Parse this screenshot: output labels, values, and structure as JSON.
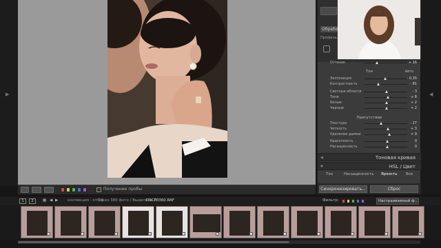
{
  "panel": {
    "tab_label": "Обработка",
    "profile_label": "Профиль:",
    "tone_title": "Тон",
    "tone_auto": "Авто",
    "presence_title": "Присутствие",
    "tone_rows": [
      {
        "label": "Оттенок",
        "value": "+ 16"
      },
      {
        "label": "Экспозиция",
        "value": "- 0,35"
      },
      {
        "label": "Контрастность",
        "value": "- 81"
      },
      {
        "label": "Светлые области",
        "value": "- 3"
      },
      {
        "label": "Тени",
        "value": "+ 8"
      },
      {
        "label": "Белые",
        "value": "+ 2"
      },
      {
        "label": "Черные",
        "value": "+ 2"
      }
    ],
    "presence_rows": [
      {
        "label": "Текстура",
        "value": "- 27"
      },
      {
        "label": "Четкость",
        "value": "+ 3"
      },
      {
        "label": "Удаление дымки",
        "value": "+ 9"
      },
      {
        "label": "Красочность",
        "value": "0"
      },
      {
        "label": "Насыщенность",
        "value": "0"
      }
    ],
    "tone_curve_label": "Тоновая кривая",
    "hsl_label": "HSL / Цвет",
    "hsl_tabs": [
      "Тон",
      "Насыщенность",
      "Яркость",
      "Все"
    ],
    "sync_button": "Синхронизировать...",
    "reset_button": "Сброс"
  },
  "toolbar": {
    "soft_proof_label": "Получение пробы"
  },
  "filmstrip": {
    "page_1": "1",
    "page_2": "2",
    "collection_text": "коллекция : отбор",
    "count_text": "18 из 380 фото / Выделено 2/",
    "filename": "DSCF0360.RAF",
    "filter_label": "Фильтр:",
    "filter_select": "Настраиваемый ф...",
    "cells": [
      {
        "num": "",
        "orientation": "portrait",
        "selected": false
      },
      {
        "num": "",
        "orientation": "portrait",
        "selected": false
      },
      {
        "num": "",
        "orientation": "portrait",
        "selected": false
      },
      {
        "num": "",
        "orientation": "portrait",
        "selected": true
      },
      {
        "num": "",
        "orientation": "portrait",
        "selected": true
      },
      {
        "num": "",
        "orientation": "landscape",
        "selected": false
      },
      {
        "num": "",
        "orientation": "portrait",
        "selected": false
      },
      {
        "num": "",
        "orientation": "portrait",
        "selected": false
      },
      {
        "num": "",
        "orientation": "portrait",
        "selected": false
      },
      {
        "num": "",
        "orientation": "portrait",
        "selected": false
      },
      {
        "num": "",
        "orientation": "portrait",
        "selected": false
      },
      {
        "num": "",
        "orientation": "portrait",
        "selected": false
      }
    ]
  },
  "colors": {
    "label_red": "#d24a4a",
    "label_yellow": "#d8c64a",
    "label_green": "#5ab04a",
    "label_blue": "#4a72d0",
    "label_purple": "#9a5ac8",
    "filmstrip_cell": "#b89e9b",
    "filmstrip_selected": "#e7e3e2"
  },
  "icons": {
    "panel_left_arrow": "◀",
    "panel_right_arrow": "▶",
    "collapse_triangle": "◀",
    "expand_triangle": "▼"
  }
}
